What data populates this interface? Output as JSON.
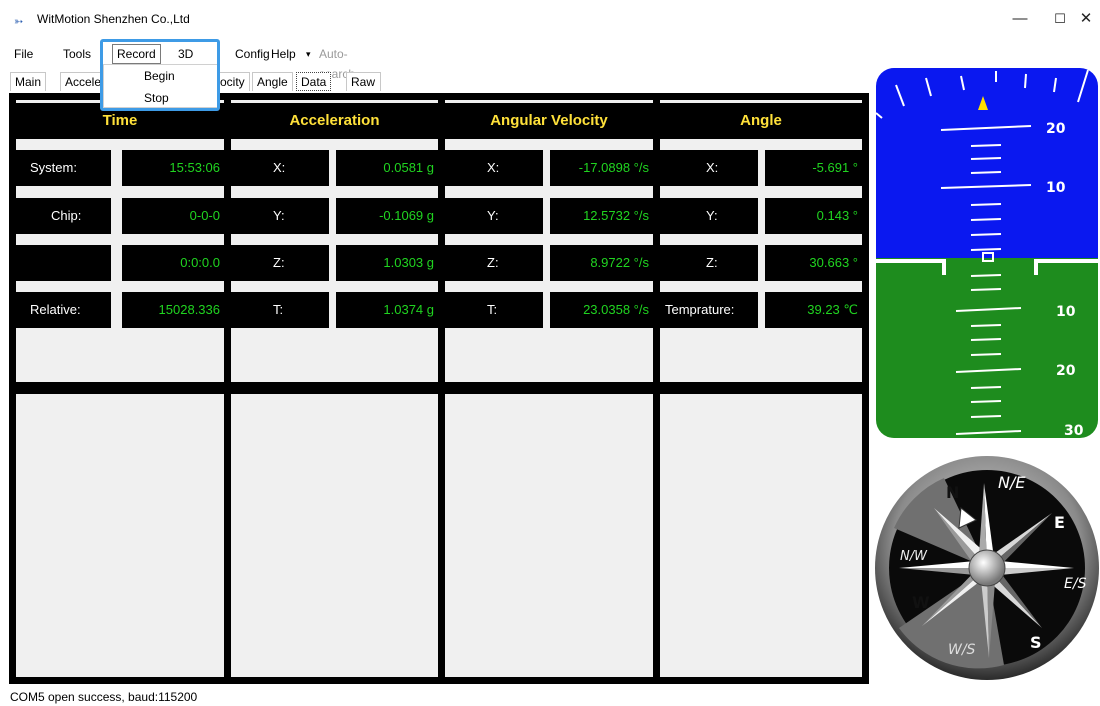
{
  "window": {
    "title": "WitMotion Shenzhen Co.,Ltd",
    "controls": {
      "minimize": "—",
      "maximize": "☐",
      "close": "✕"
    }
  },
  "menu": {
    "file": "File",
    "tools": "Tools",
    "record": "Record",
    "three_d": "3D",
    "config": "Config",
    "help": "Help",
    "help_arrow": "▾",
    "auto_search": "Auto-search"
  },
  "record_menu": {
    "begin": "Begin",
    "stop": "Stop"
  },
  "tabs": [
    "Main",
    "Acceler",
    "ocity",
    "Angle",
    "Data",
    "Raw Data"
  ],
  "headers": {
    "time": "Time",
    "acceleration": "Acceleration",
    "angular_velocity": "Angular Velocity",
    "angle": "Angle"
  },
  "time": {
    "system_label": "System:",
    "system_value": "15:53:06",
    "chip_label": "Chip:",
    "chip_value": "0-0-0",
    "blank_value": "0:0:0.0",
    "relative_label": "Relative:",
    "relative_value": "15028.336"
  },
  "acceleration": {
    "x_label": "X:",
    "x_value": "0.0581 g",
    "y_label": "Y:",
    "y_value": "-0.1069 g",
    "z_label": "Z:",
    "z_value": "1.0303 g",
    "t_label": "T:",
    "t_value": "1.0374 g"
  },
  "angular_velocity": {
    "x_label": "X:",
    "x_value": "-17.0898 °/s",
    "y_label": "Y:",
    "y_value": "12.5732 °/s",
    "z_label": "Z:",
    "z_value": "8.9722 °/s",
    "t_label": "T:",
    "t_value": "23.0358 °/s"
  },
  "angle": {
    "x_label": "X:",
    "x_value": "-5.691 °",
    "y_label": "Y:",
    "y_value": "0.143 °",
    "z_label": "Z:",
    "z_value": "30.663 °",
    "temp_label": "Temprature:",
    "temp_value": "39.23 ℃"
  },
  "attitude_indicator": {
    "pitch_labels": [
      "20",
      "10",
      "10",
      "20",
      "30"
    ],
    "sky_color": "#0a18f0",
    "ground_color": "#1e8c1e"
  },
  "compass": {
    "labels": {
      "n": "N",
      "ne": "N/E",
      "e": "E",
      "se": "E/S",
      "s": "S",
      "sw": "W/S",
      "w": "W",
      "nw": "N/W"
    }
  },
  "status": {
    "text": "COM5 open success, baud:115200"
  }
}
